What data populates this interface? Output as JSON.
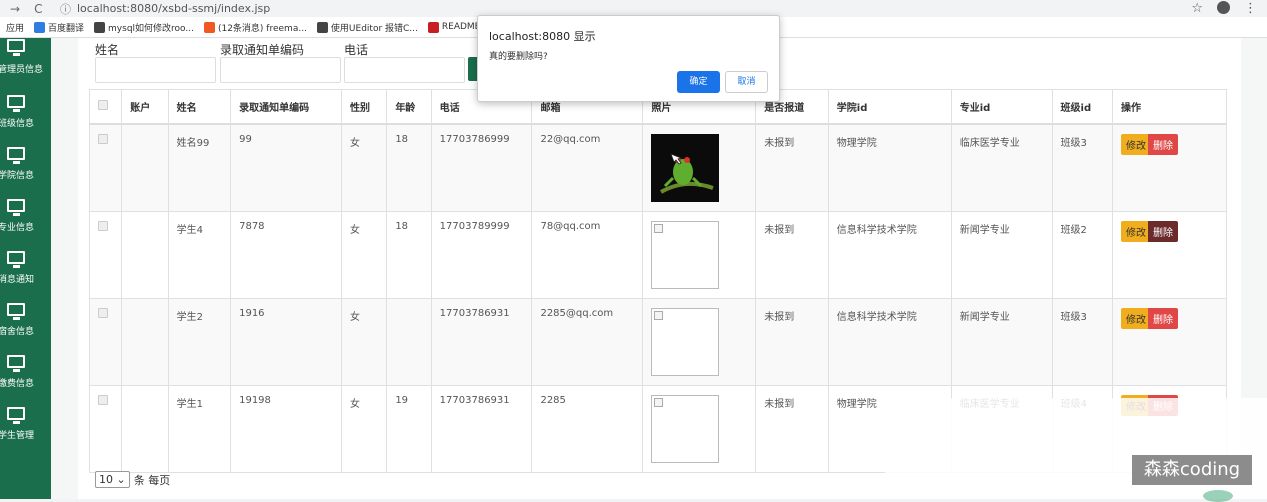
{
  "browser": {
    "url": "localhost:8080/xsbd-ssmj/index.jsp",
    "bookmarks": [
      {
        "label": "应用",
        "icon_color": "#4b8fe8"
      },
      {
        "label": "百度翻译",
        "icon_color": "#2f7de1"
      },
      {
        "label": "mysql如何修改roo...",
        "icon_color": "#444444"
      },
      {
        "label": "(12条消息) freema...",
        "icon_color": "#f05a22"
      },
      {
        "label": "使用UEditor 报错C...",
        "icon_color": "#444444"
      },
      {
        "label": "README.md ·",
        "icon_color": "#c71d23"
      }
    ]
  },
  "sidebar": {
    "items": [
      {
        "label": "管理员信息",
        "icon": "monitor-icon"
      },
      {
        "label": "班级信息",
        "icon": "monitor-icon"
      },
      {
        "label": "学院信息",
        "icon": "monitor-icon"
      },
      {
        "label": "专业信息",
        "icon": "monitor-icon"
      },
      {
        "label": "消息通知",
        "icon": "monitor-icon"
      },
      {
        "label": "宿舍信息",
        "icon": "monitor-icon"
      },
      {
        "label": "缴费信息",
        "icon": "monitor-icon"
      },
      {
        "label": "学生管理",
        "icon": "monitor-icon"
      }
    ]
  },
  "search": {
    "name_label": "姓名",
    "code_label": "录取通知单编码",
    "phone_label": "电话"
  },
  "table": {
    "headers": [
      "",
      "账户",
      "姓名",
      "录取通知单编码",
      "性别",
      "年龄",
      "电话",
      "邮箱",
      "照片",
      "是否报道",
      "学院id",
      "专业id",
      "班级id",
      "操作"
    ],
    "rows": [
      {
        "account": "",
        "name": "姓名99",
        "code": "99",
        "gender": "女",
        "age": "18",
        "phone": "17703786999",
        "email": "22@qq.com",
        "photo": "frog",
        "reported": "未报到",
        "college": "物理学院",
        "major": "临床医学专业",
        "class": "班级3"
      },
      {
        "account": "",
        "name": "学生4",
        "code": "7878",
        "gender": "女",
        "age": "18",
        "phone": "17703789999",
        "email": "78@qq.com",
        "photo": "broken",
        "reported": "未报到",
        "college": "信息科学技术学院",
        "major": "新闻学专业",
        "class": "班级2"
      },
      {
        "account": "",
        "name": "学生2",
        "code": "1916",
        "gender": "女",
        "age": "",
        "phone": "17703786931",
        "email": "2285@qq.com",
        "photo": "broken",
        "reported": "未报到",
        "college": "信息科学技术学院",
        "major": "新闻学专业",
        "class": "班级3"
      },
      {
        "account": "",
        "name": "学生1",
        "code": "19198",
        "gender": "女",
        "age": "19",
        "phone": "17703786931",
        "email": "2285",
        "photo": "broken",
        "reported": "未报到",
        "college": "物理学院",
        "major": "临床医学专业",
        "class": "班级4"
      }
    ],
    "edit_label": "修改",
    "delete_label": "删除"
  },
  "pager": {
    "page_size": "10",
    "suffix": "条 每页"
  },
  "dialog": {
    "title": "localhost:8080 显示",
    "message": "真的要删除吗?",
    "ok_label": "确定",
    "cancel_label": "取消"
  },
  "watermark": "森森coding"
}
